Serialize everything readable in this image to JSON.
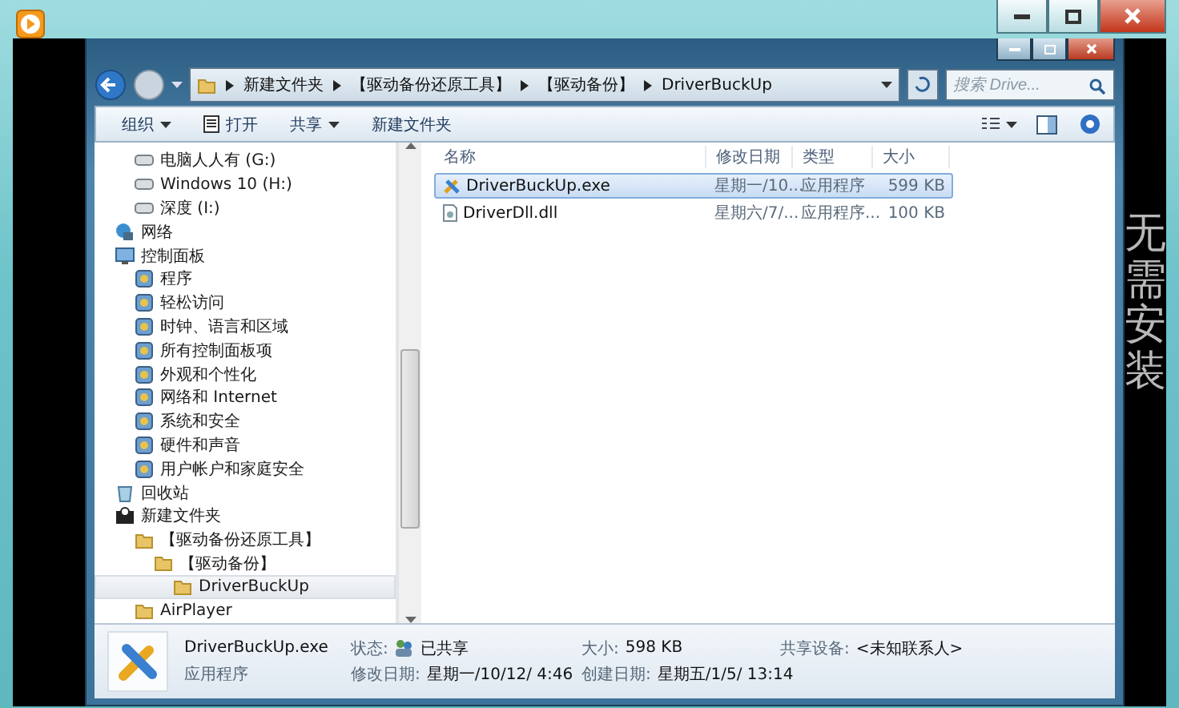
{
  "caption": "无需安装",
  "explorer": {
    "breadcrumb": [
      "新建文件夹",
      "【驱动备份还原工具】",
      "【驱动备份】",
      "DriverBuckUp"
    ],
    "search": {
      "placeholder": "搜索 Drive..."
    },
    "toolbar": [
      {
        "label": "组织",
        "kind": "menu"
      },
      {
        "label": "打开",
        "kind": "open"
      },
      {
        "label": "共享",
        "kind": "menu"
      },
      {
        "label": "新建文件夹",
        "kind": "plain"
      }
    ],
    "nav": [
      {
        "children": [
          {
            "label": "电脑人人有 (G:)",
            "kind": "drive",
            "selected": false
          },
          {
            "label": "Windows 10 (H:)",
            "kind": "drive",
            "selected": false
          },
          {
            "label": "深度 (I:)",
            "kind": "drive",
            "selected": false
          }
        ]
      },
      {
        "label": "网络",
        "kind": "network",
        "selected": false
      },
      {
        "label": "控制面板",
        "kind": "control-panel",
        "selected": false,
        "children": [
          {
            "label": "程序",
            "kind": "applet",
            "selected": false
          },
          {
            "label": "轻松访问",
            "kind": "applet",
            "selected": false
          },
          {
            "label": "时钟、语言和区域",
            "kind": "applet",
            "selected": false
          },
          {
            "label": "所有控制面板项",
            "kind": "applet",
            "selected": false
          },
          {
            "label": "外观和个性化",
            "kind": "applet",
            "selected": false
          },
          {
            "label": "网络和 Internet",
            "kind": "applet",
            "selected": false
          },
          {
            "label": "系统和安全",
            "kind": "applet",
            "selected": false
          },
          {
            "label": "硬件和声音",
            "kind": "applet",
            "selected": false
          },
          {
            "label": "用户帐户和家庭安全",
            "kind": "applet",
            "selected": false
          }
        ]
      },
      {
        "label": "回收站",
        "kind": "recycle-bin",
        "selected": false
      },
      {
        "label": "新建文件夹",
        "kind": "user-folder",
        "selected": false,
        "children": [
          {
            "label": "【驱动备份还原工具】",
            "kind": "folder",
            "selected": false,
            "children": [
              {
                "label": "【驱动备份】",
                "kind": "folder",
                "selected": false,
                "children": [
                  {
                    "label": "DriverBuckUp",
                    "kind": "folder",
                    "selected": true
                  }
                ]
              }
            ]
          },
          {
            "label": "AirPlayer",
            "kind": "folder",
            "selected": false
          }
        ]
      }
    ],
    "columns": [
      "名称",
      "修改日期",
      "类型",
      "大小"
    ],
    "files": [
      {
        "name": "DriverBuckUp.exe",
        "kind": "exe",
        "date": "星期一/10...",
        "type": "应用程序",
        "size": "599 KB",
        "selected": true
      },
      {
        "name": "DriverDll.dll",
        "kind": "dll",
        "date": "星期六/7/...",
        "type": "应用程序...",
        "size": "100 KB",
        "selected": false
      }
    ],
    "details": {
      "name": "DriverBuckUp.exe",
      "type": "应用程序",
      "fields": [
        {
          "label": "状态:",
          "value": "已共享",
          "kind": "shared"
        },
        {
          "label": "大小:",
          "value": "598 KB",
          "kind": "plain"
        },
        {
          "label": "共享设备:",
          "value": "<未知联系人>",
          "kind": "plain"
        },
        {
          "label": "修改日期:",
          "value": "星期一/10/12/ 4:46",
          "kind": "plain"
        },
        {
          "label": "创建日期:",
          "value": "星期五/1/5/ 13:14",
          "kind": "plain"
        }
      ]
    }
  }
}
